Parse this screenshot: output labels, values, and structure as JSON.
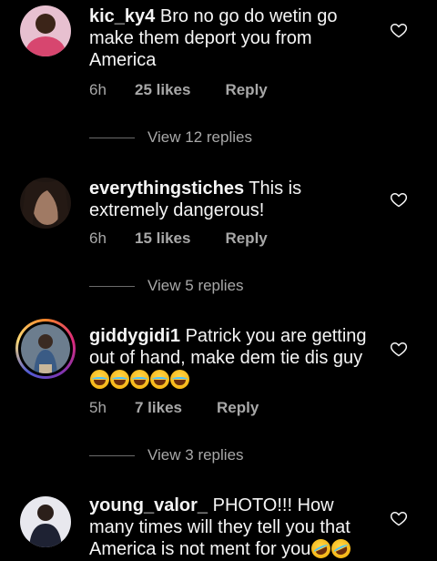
{
  "comments": [
    {
      "username": "kic_ky4",
      "text": "Bro no go do wetin go make them deport you from America",
      "time": "6h",
      "likes": "25 likes",
      "reply": "Reply",
      "view_replies": "View 12 replies",
      "avatar_color": "#c4456d"
    },
    {
      "username": "everythingstiches",
      "text": "This is extremely dangerous!",
      "time": "6h",
      "likes": "15 likes",
      "reply": "Reply",
      "view_replies": "View 5 replies",
      "avatar_color": "#5a3b33"
    },
    {
      "username": "giddygidi1",
      "text": "Patrick you are getting out of hand, make dem tie dis guy",
      "emojis": [
        "face-with-tears-of-joy",
        "face-with-tears-of-joy",
        "face-with-tears-of-joy",
        "face-with-tears-of-joy",
        "face-with-tears-of-joy"
      ],
      "time": "5h",
      "likes": "7 likes",
      "reply": "Reply",
      "view_replies": "View 3 replies",
      "avatar_color": "#4a5a6a"
    },
    {
      "username": "young_valor_",
      "text": "PHOTO!!! How many times will they tell you that America is not ment for you",
      "emojis": [
        "rolling-on-the-floor-laughing",
        "rolling-on-the-floor-laughing"
      ],
      "avatar_color": "#3a3f5a"
    }
  ],
  "icons": {
    "heart": "heart-outline-icon"
  },
  "colors": {
    "background": "#000000",
    "text": "#f5f5f5",
    "meta": "#a8a8a8"
  }
}
